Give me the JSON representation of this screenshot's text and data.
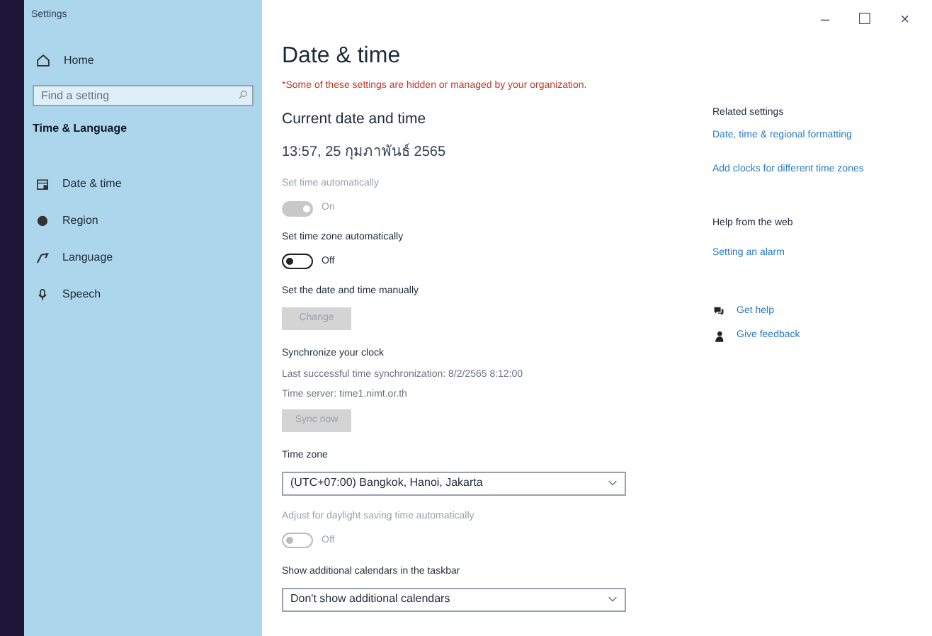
{
  "window": {
    "title": "Settings",
    "controls": [
      "–",
      "☐",
      "×"
    ]
  },
  "sidebar": {
    "home": "Home",
    "search": {
      "placeholder": "Find a setting"
    },
    "section": "Time & Language",
    "items": [
      {
        "label": "Date & time"
      },
      {
        "label": "Region"
      },
      {
        "label": "Language"
      },
      {
        "label": "Speech"
      }
    ]
  },
  "main": {
    "title": "Date & time",
    "warning": "*Some of these settings are hidden or managed by your organization.",
    "blocks": [
      {
        "kind": "heading",
        "text": "Current date and time"
      },
      {
        "kind": "text",
        "text": "13:57, 25 กุมภาพันธ์ 2565"
      },
      {
        "kind": "toggle",
        "label": "Set time automatically",
        "disabled": true,
        "on": true,
        "state_text": "On"
      },
      {
        "kind": "toggle",
        "label": "Set time zone automatically",
        "disabled": false,
        "on": false,
        "state_text": "Off"
      },
      {
        "kind": "button",
        "label": "Set the date and time manually",
        "button": "Change",
        "disabled": true
      },
      {
        "kind": "sync",
        "label": "Synchronize your clock",
        "lines": [
          "Last successful time synchronization: 8/2/2565 8:12:00",
          "Time server: time1.nimt.or.th"
        ],
        "button": "Sync now",
        "disabled": true
      },
      {
        "kind": "dropdown",
        "label": "Time zone",
        "value": "(UTC+07:00) Bangkok, Hanoi, Jakarta"
      },
      {
        "kind": "toggle",
        "label": "Adjust for daylight saving time automatically",
        "disabled": true,
        "on": false,
        "state_text": "Off"
      },
      {
        "kind": "dropdown",
        "label": "Show additional calendars in the taskbar",
        "value": "Don't show additional calendars"
      }
    ]
  },
  "related": {
    "heading": "Related settings",
    "links": [
      "Date, time & regional formatting",
      "Add clocks for different time zones"
    ]
  },
  "help": {
    "heading": "Help from the web",
    "links": [
      "Setting an alarm"
    ]
  },
  "support": [
    {
      "label": "Get help"
    },
    {
      "label": "Give feedback"
    }
  ]
}
